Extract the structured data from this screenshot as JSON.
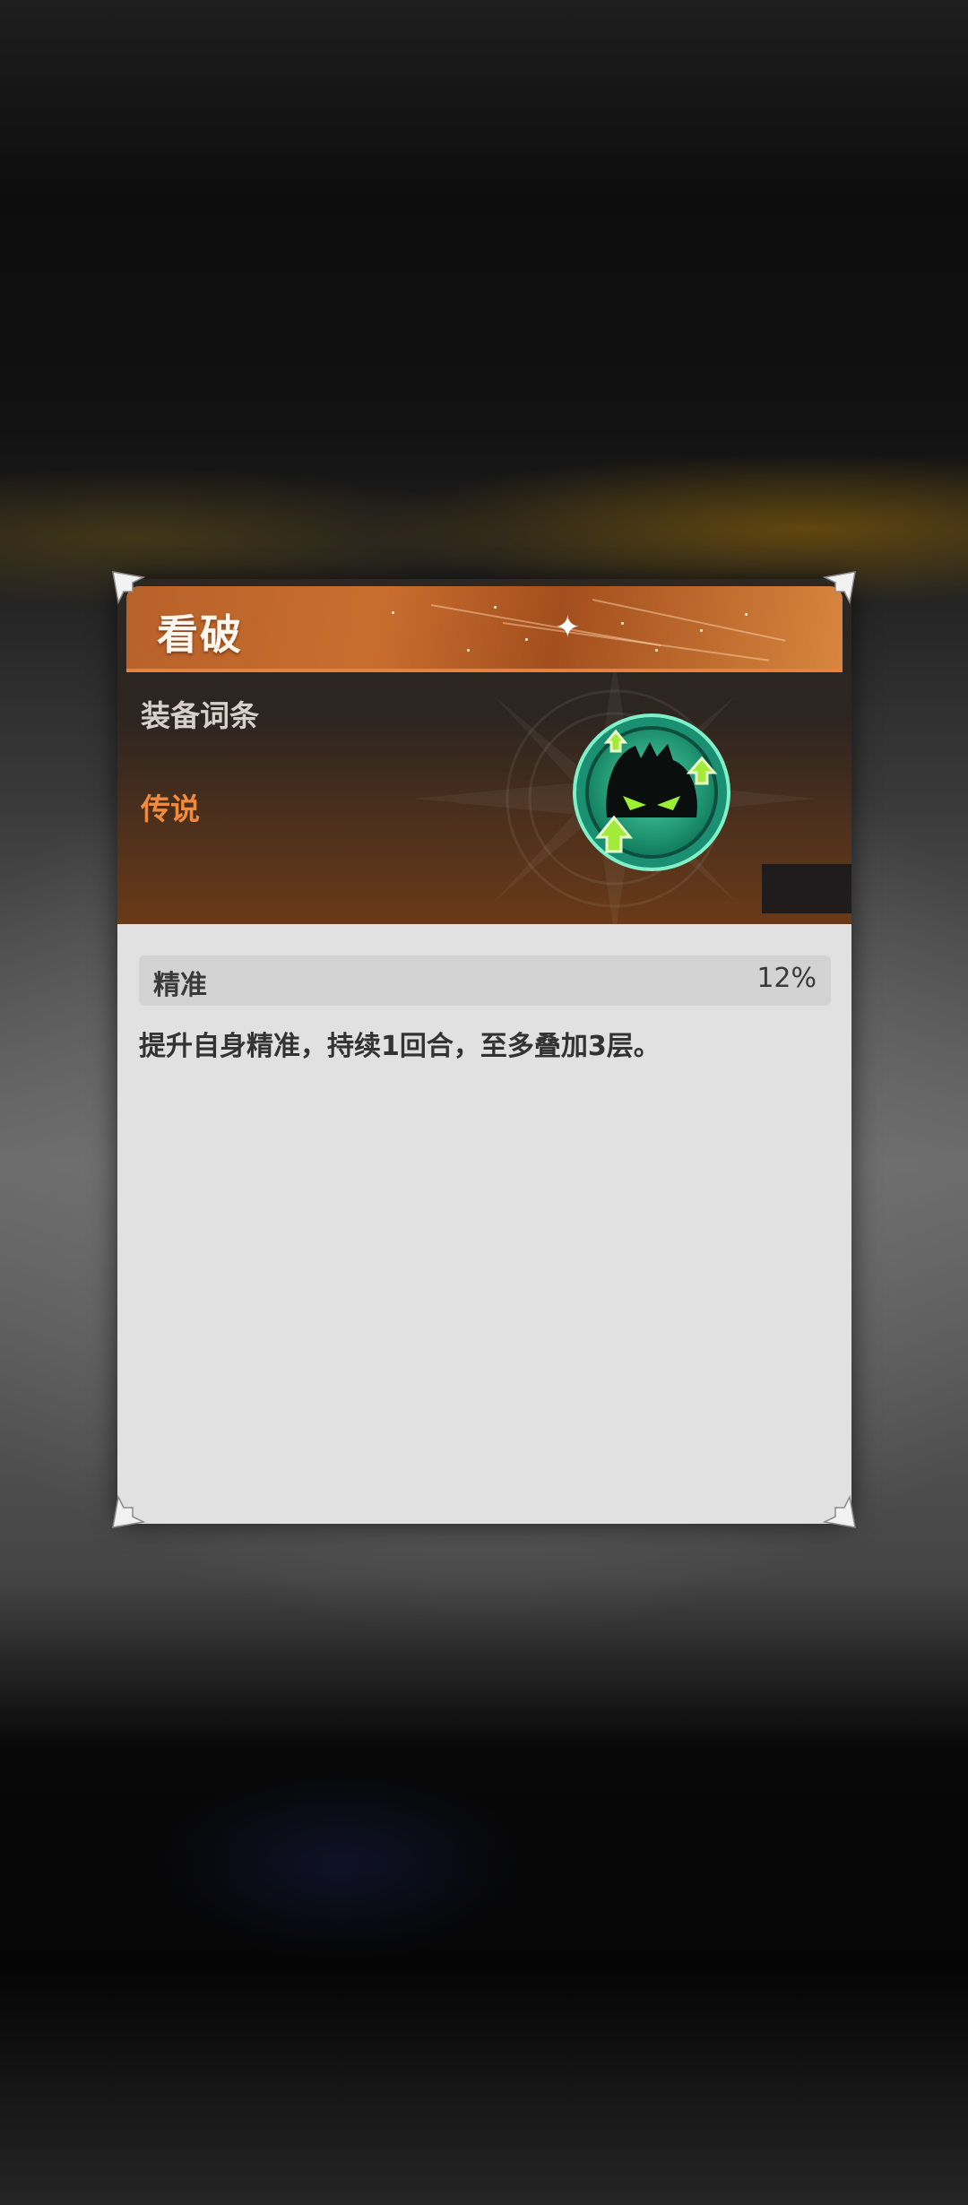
{
  "dialog": {
    "title": "看破",
    "category": "装备词条",
    "rarity": "传说",
    "stat": {
      "name": "精准",
      "value": "12%"
    },
    "description": "提升自身精准，持续1回合，至多叠加3层。"
  },
  "icons": {
    "emblem": "green-eyed-spirit-emblem-icon",
    "sparkle": "sparkle-icon",
    "background": "compass-star-icon",
    "corners": "corner-ornament-icon"
  },
  "colors": {
    "title_bar": "#c96e2e",
    "rarity": "#ef8a3e",
    "card_body": "#e1e1e1",
    "stat_row": "#d3d3d3",
    "emblem_green": "#8fe832",
    "emblem_ring": "#1c9c7a"
  }
}
